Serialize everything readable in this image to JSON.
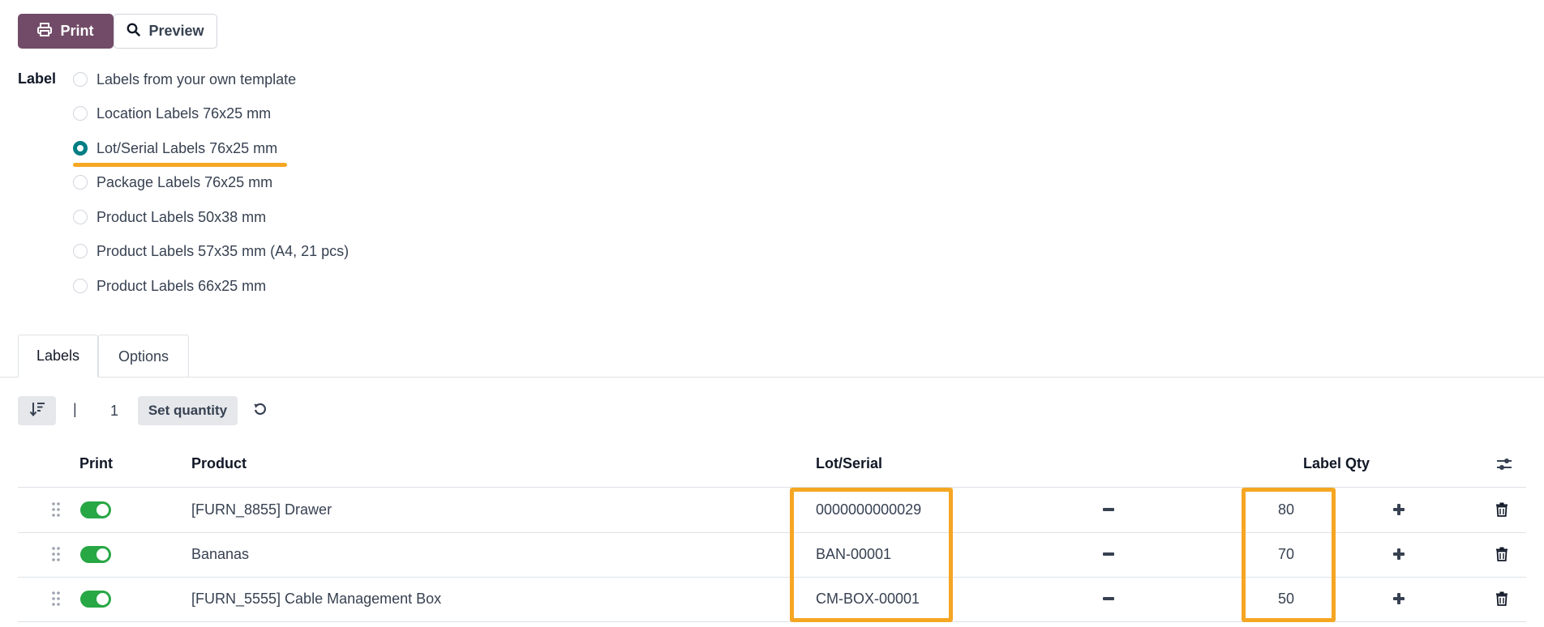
{
  "toolbar": {
    "print_label": "Print",
    "preview_label": "Preview"
  },
  "label_section": {
    "title": "Label",
    "options": [
      {
        "text": "Labels from your own template",
        "checked": false
      },
      {
        "text": "Location Labels 76x25 mm",
        "checked": false
      },
      {
        "text": "Lot/Serial Labels 76x25 mm",
        "checked": true
      },
      {
        "text": "Package Labels 76x25 mm",
        "checked": false
      },
      {
        "text": "Product Labels 50x38 mm",
        "checked": false
      },
      {
        "text": "Product Labels 57x35 mm (A4, 21 pcs)",
        "checked": false
      },
      {
        "text": "Product Labels 66x25 mm",
        "checked": false
      }
    ]
  },
  "tabs": [
    {
      "label": "Labels",
      "active": true
    },
    {
      "label": "Options",
      "active": false
    }
  ],
  "list_toolbar": {
    "pipe": "|",
    "quantity": "1",
    "set_quantity_label": "Set quantity"
  },
  "table": {
    "headers": {
      "print": "Print",
      "product": "Product",
      "lot": "Lot/Serial",
      "qty": "Label Qty"
    },
    "rows": [
      {
        "print": true,
        "product": "[FURN_8855] Drawer",
        "lot": "0000000000029",
        "qty": "80"
      },
      {
        "print": true,
        "product": "Bananas",
        "lot": "BAN-00001",
        "qty": "70"
      },
      {
        "print": true,
        "product": "[FURN_5555] Cable Management Box",
        "lot": "CM-BOX-00001",
        "qty": "50"
      }
    ]
  },
  "colors": {
    "primary": "#714B67",
    "radio_checked": "#017E84",
    "toggle_on": "#28a745",
    "highlight": "#F5A623"
  }
}
